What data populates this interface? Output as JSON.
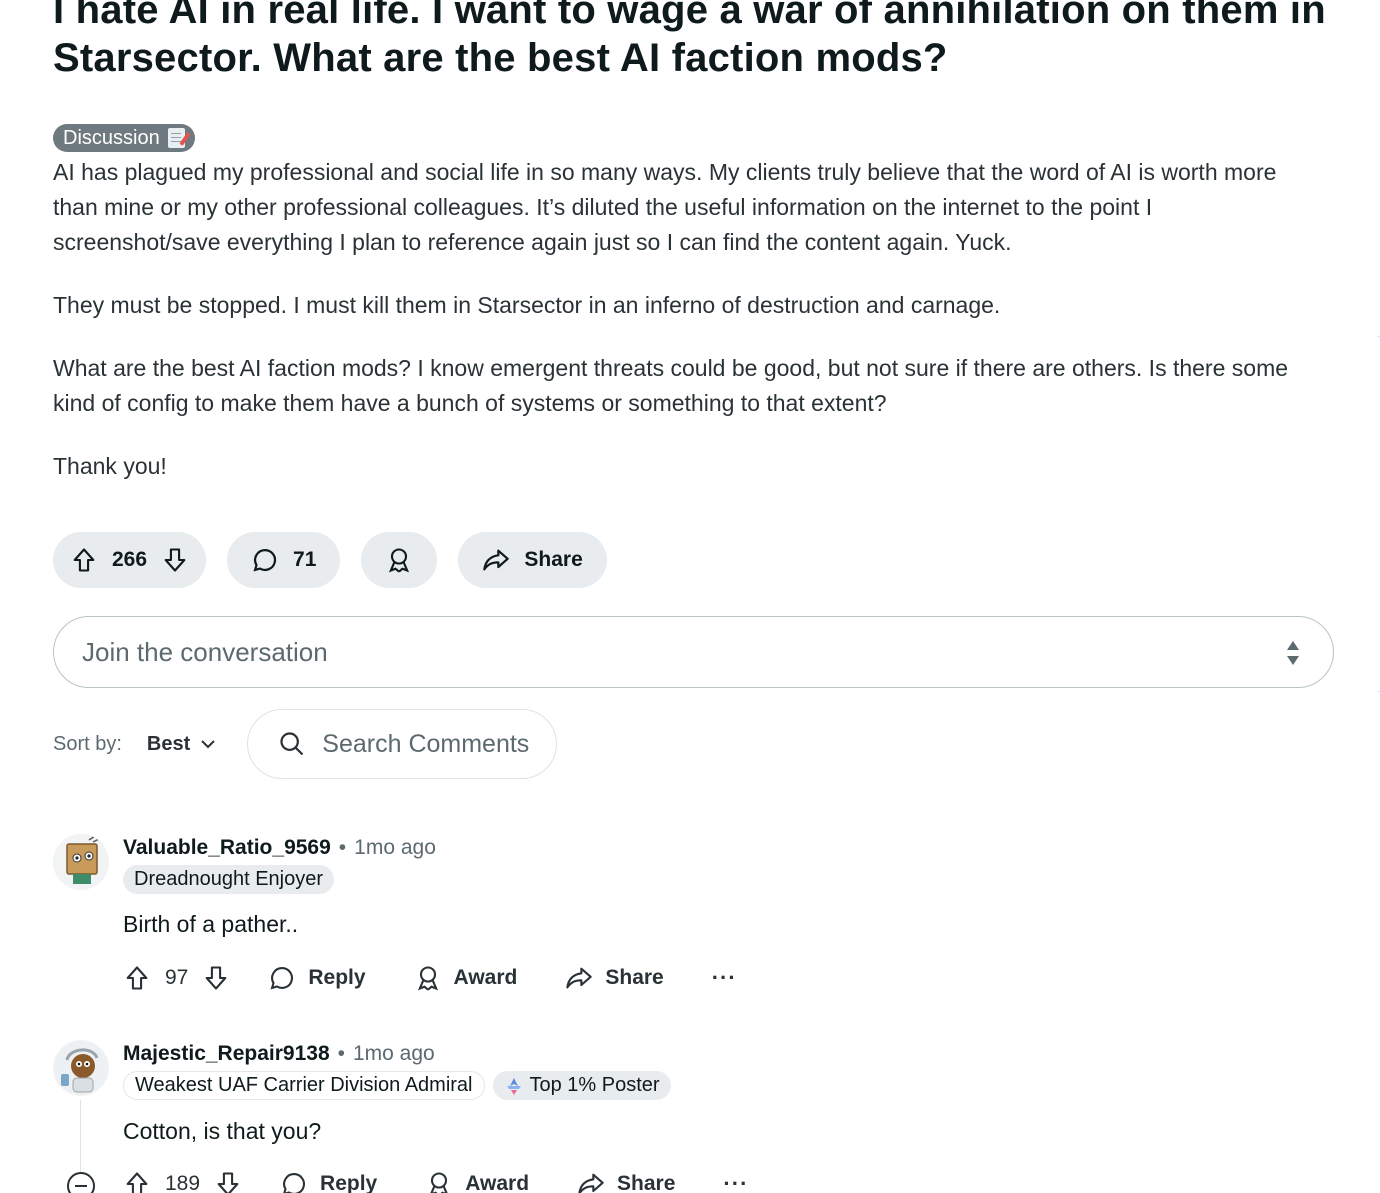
{
  "post": {
    "title": "I hate AI in real life. I want to wage a war of annihilation on them in Starsector. What are the best AI faction mods?",
    "flair": "Discussion",
    "paragraphs": [
      "AI has plagued my professional and social life in so many ways. My clients truly believe that the word of AI is worth more than mine or my other professional colleagues. It’s diluted the useful information on the internet to the point I screenshot/save everything I plan to reference again just so I can find the content again. Yuck.",
      "They must be stopped. I must kill them in Starsector in an inferno of destruction and carnage.",
      "What are the best AI faction mods? I know emergent threats could be good, but not sure if there are others. Is there some kind of config to make them have a bunch of systems or something to that extent?",
      "Thank you!"
    ],
    "score": "266",
    "comments": "71",
    "share_label": "Share"
  },
  "composer": {
    "placeholder": "Join the conversation"
  },
  "sort": {
    "label": "Sort by:",
    "value": "Best"
  },
  "search": {
    "placeholder": "Search Comments"
  },
  "comments": [
    {
      "user": "Valuable_Ratio_9569",
      "time": "1mo ago",
      "flairs": [
        "Dreadnought Enjoyer"
      ],
      "text": "Birth of a pather..",
      "score": "97",
      "reply": "Reply",
      "award": "Award",
      "share": "Share",
      "more": "···"
    },
    {
      "user": "Majestic_Repair9138",
      "time": "1mo ago",
      "flairs": [
        "Weakest UAF Carrier Division Admiral",
        "Top 1% Poster"
      ],
      "text": "Cotton, is that you?",
      "score": "189",
      "reply": "Reply",
      "award": "Award",
      "share": "Share",
      "more": "···"
    }
  ],
  "icons": {
    "upvote": "arrow-up-outline",
    "downvote": "arrow-down-outline",
    "comment": "speech-bubble",
    "award": "award-ribbon",
    "share": "share-arrow",
    "search": "magnifier",
    "chevron": "chevron-down"
  },
  "colors": {
    "text": "#0f1a1c",
    "muted": "#5c6a70",
    "pill_bg": "#e8ecee",
    "flair_bg": "#6f7a80"
  }
}
